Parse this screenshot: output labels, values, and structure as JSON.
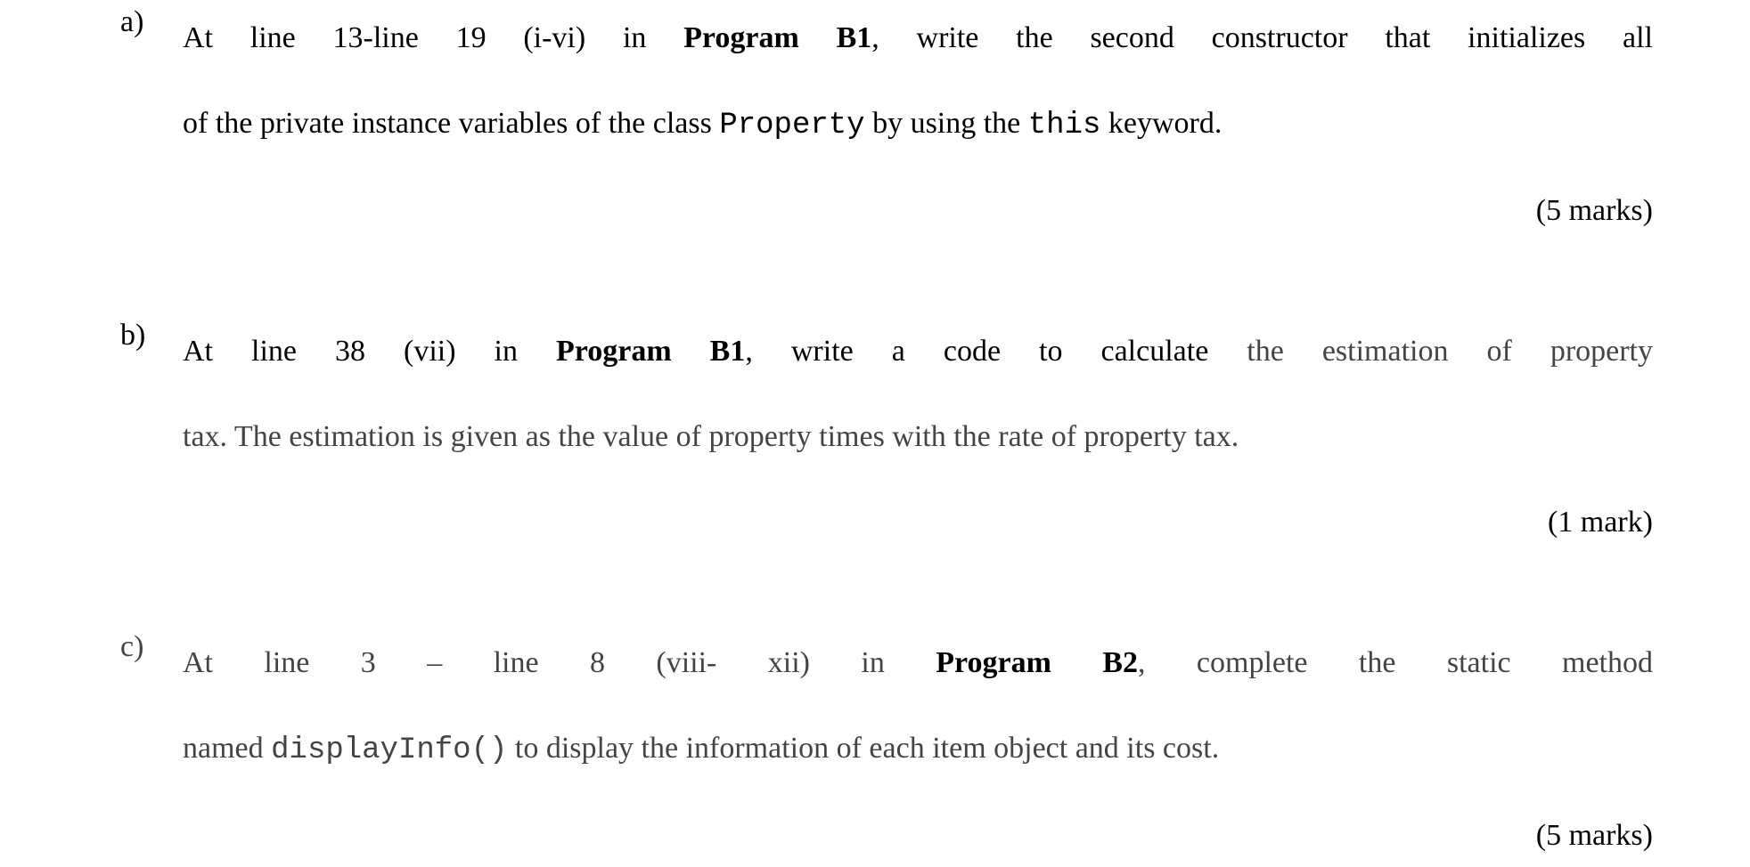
{
  "items": [
    {
      "label": "a)",
      "line1_pre": "At line 13-line 19 (i-vi) in ",
      "line1_bold": "Program B1",
      "line1_post": ", write the second constructor that initializes all",
      "line2_pre": "of the private instance variables of the class ",
      "line2_code1": "Property",
      "line2_mid": " by using the ",
      "line2_code2": "this",
      "line2_post": " keyword.",
      "marks": "(5 marks)"
    },
    {
      "label": "b)",
      "line1_pre": "At line 38 (vii) in ",
      "line1_bold": "Program B1",
      "line1_mid": ", write a code to calculate ",
      "line1_dim": "the estimation of property",
      "line2_dim": "tax. The estimation is given as the value of property times with the rate of property tax.",
      "marks": "(1 mark)"
    },
    {
      "label": "c)",
      "line1_dim_pre": "At line 3 – line 8 (viii- xii) in",
      "line1_bold": " Program B2",
      "line1_dim_post": ", complete the static method",
      "line2_dim_pre": "named ",
      "line2_code": "displayInfo()",
      "line2_dim_post": " to display the information of each item object and its cost.",
      "marks": "(5 marks)"
    }
  ]
}
